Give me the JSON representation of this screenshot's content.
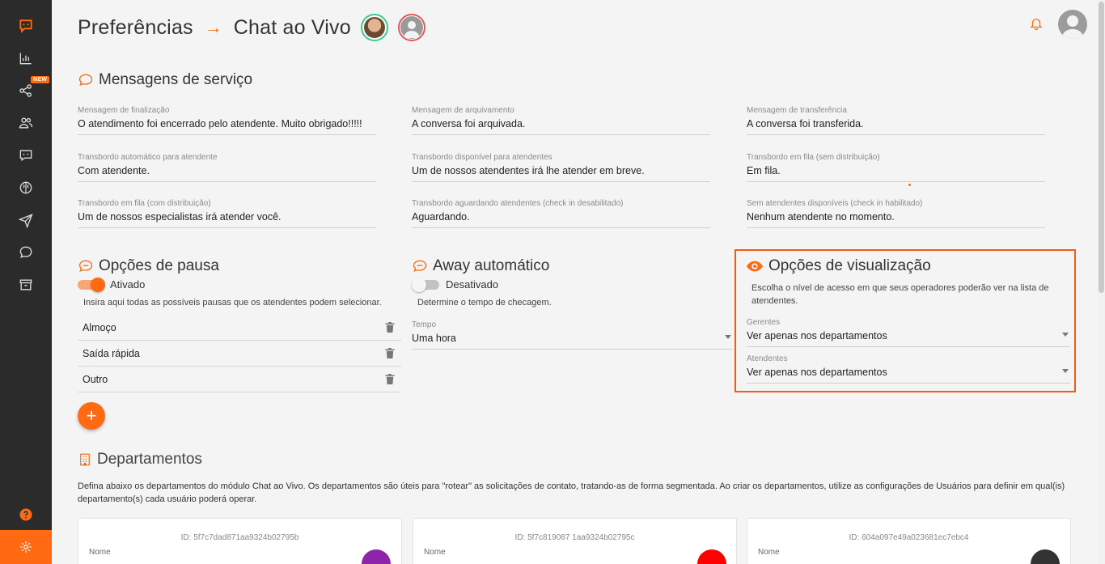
{
  "sidebar": {
    "new_badge": "NEW",
    "items": [
      {
        "icon": "chat-logo-icon"
      },
      {
        "icon": "bar-chart-icon"
      },
      {
        "icon": "share-nodes-icon"
      },
      {
        "icon": "users-icon"
      },
      {
        "icon": "chat-bubble-square-icon"
      },
      {
        "icon": "brain-icon"
      },
      {
        "icon": "paper-plane-icon"
      },
      {
        "icon": "message-circle-icon"
      },
      {
        "icon": "archive-icon"
      }
    ],
    "help_icon": "question-circle-icon",
    "settings_icon": "gear-icon"
  },
  "header": {
    "title": "Preferências",
    "arrow": "→",
    "subtitle": "Chat ao Vivo"
  },
  "service_messages": {
    "title": "Mensagens de serviço",
    "fields": [
      {
        "label": "Mensagem de finalização",
        "value": "O atendimento foi encerrado pelo atendente. Muito obrigado!!!!!"
      },
      {
        "label": "Mensagem de arquivamento",
        "value": "A conversa foi arquivada."
      },
      {
        "label": "Mensagem de transferência",
        "value": "A conversa foi transferida."
      },
      {
        "label": "Transbordo automático para atendente",
        "value": "Com atendente."
      },
      {
        "label": "Transbordo disponível para atendentes",
        "value": "Um de nossos atendentes irá lhe atender em breve."
      },
      {
        "label": "Transbordo em fila (sem distribuição)",
        "value": "Em fila."
      },
      {
        "label": "Transbordo em fila (com distribuição)",
        "value": "Um de nossos especialistas irá atender você."
      },
      {
        "label": "Transbordo aguardando atendentes (check in desabilitado)",
        "value": "Aguardando."
      },
      {
        "label": "Sem atendentes disponíveis (check in habilitado)",
        "value": "Nenhum atendente no momento."
      }
    ]
  },
  "pause_options": {
    "title": "Opções de pausa",
    "toggle_label": "Ativado",
    "enabled": true,
    "hint": "Insira aqui todas as possíveis pausas que os atendentes podem selecionar.",
    "items": [
      "Almoço",
      "Saída rápida",
      "Outro"
    ],
    "add_label": "+"
  },
  "away": {
    "title": "Away automático",
    "toggle_label": "Desativado",
    "enabled": false,
    "hint": "Determine o tempo de checagem.",
    "time_label": "Tempo",
    "time_value": "Uma hora"
  },
  "visibility": {
    "title": "Opções de visualização",
    "description": "Escolha o nível de acesso em que seus operadores poderão ver na lista de atendentes.",
    "managers_label": "Gerentes",
    "managers_value": "Ver apenas nos departamentos",
    "agents_label": "Atendentes",
    "agents_value": "Ver apenas nos departamentos"
  },
  "departments": {
    "title": "Departamentos",
    "description": "Defina abaixo os departamentos do módulo Chat ao Vivo. Os departamentos são úteis para \"rotear\" as solicitações de contato, tratando-as de forma segmentada. Ao criar os departamentos, utilize as configurações de Usuários para definir em qual(is) departamento(s) cada usuário poderá operar.",
    "cards": [
      {
        "id": "ID: 5f7c7dad871aa9324b02795b",
        "name_label": "Nome",
        "color": "#8e24aa"
      },
      {
        "id": "ID: 5f7c819087 1aa9324b02795c",
        "name_label": "Nome",
        "color": "#ff0000"
      },
      {
        "id": "ID: 604a097e49a023681ec7ebc4",
        "name_label": "Nome",
        "color": "#333333"
      }
    ]
  },
  "colors": {
    "accent": "#ff6a13",
    "sidebar": "#2b2b2b",
    "highlight": "#f25c19"
  }
}
